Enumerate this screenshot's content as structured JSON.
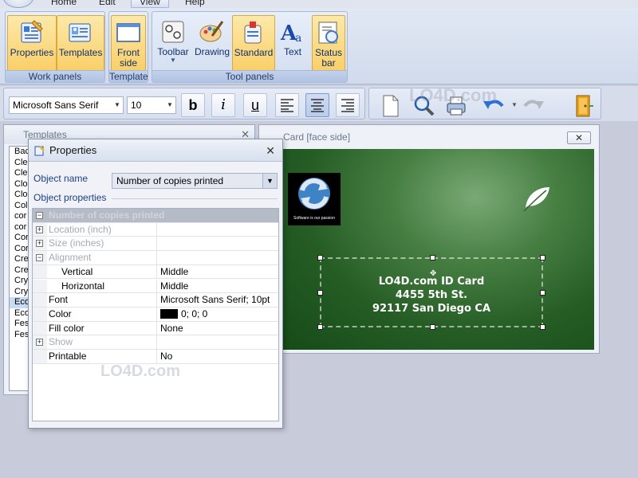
{
  "menubar": {
    "items": [
      "Home",
      "Edit",
      "View",
      "Help"
    ],
    "active": "View"
  },
  "ribbon": {
    "groups": [
      {
        "label": "Work panels",
        "buttons": [
          "Properties",
          "Templates"
        ]
      },
      {
        "label": "Template",
        "buttons": [
          "Front side"
        ]
      },
      {
        "label": "Tool panels",
        "buttons": [
          "Toolbar",
          "Drawing",
          "Standard",
          "Text",
          "Status bar"
        ]
      }
    ]
  },
  "format_toolbar": {
    "font": "Microsoft Sans Serif",
    "size": "10",
    "bold": "b",
    "italic": "i",
    "underline": "u"
  },
  "watermark": "LO4D.com",
  "templates_panel": {
    "title": "Templates",
    "items": [
      "Back",
      "Cle",
      "Cle",
      "Clo",
      "Clo",
      "Col",
      "cor",
      "cor",
      "Cor",
      "Cor",
      "Cre",
      "Cre",
      "Cry",
      "Cry",
      "Eco",
      "Eco",
      "Fes",
      "Fes"
    ]
  },
  "card_window": {
    "title": "Card [face side]",
    "close": "✕",
    "logo_tagline": "Software is our passion",
    "text_lines": [
      "LO4D.com ID Card",
      "4455 5th St.",
      "92117 San Diego CA"
    ]
  },
  "properties": {
    "title": "Properties",
    "close": "✕",
    "object_name_label": "Object name",
    "object_name_value": "Number of copies printed",
    "object_properties_label": "Object properties",
    "rows": [
      {
        "name": "Number of copies printed",
        "value": "",
        "type": "header",
        "expander": "−"
      },
      {
        "name": "Location (inch)",
        "value": "",
        "type": "disabled",
        "expander": "+"
      },
      {
        "name": "Size (inches)",
        "value": "",
        "type": "disabled",
        "expander": "+"
      },
      {
        "name": "Alignment",
        "value": "",
        "type": "disabled",
        "expander": "−"
      },
      {
        "name": "Vertical",
        "value": "Middle",
        "type": "child"
      },
      {
        "name": "Horizontal",
        "value": "Middle",
        "type": "child"
      },
      {
        "name": "Font",
        "value": "Microsoft Sans Serif; 10pt",
        "type": "normal"
      },
      {
        "name": "Color",
        "value": "0; 0; 0",
        "type": "color"
      },
      {
        "name": "Fill color",
        "value": "None",
        "type": "normal"
      },
      {
        "name": "Show",
        "value": "",
        "type": "disabled",
        "expander": "+"
      },
      {
        "name": "Printable",
        "value": "No",
        "type": "normal"
      }
    ]
  },
  "colors": {
    "ribbon_selected": "#f9cf68",
    "card_green": "#2f6a2d",
    "workspace": "#c8cbda"
  }
}
